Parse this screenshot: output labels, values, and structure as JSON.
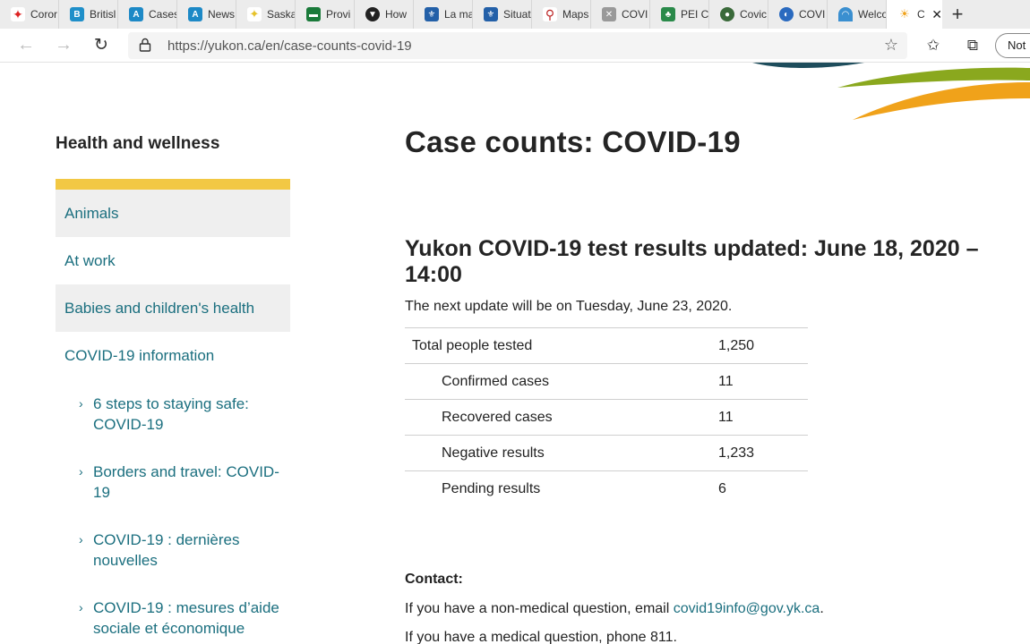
{
  "browser": {
    "tabs": [
      {
        "label": "Coror",
        "color": "#d22"
      },
      {
        "label": "Britisl",
        "color": "#1f8fc9"
      },
      {
        "label": "Cases",
        "color": "#1d89c6"
      },
      {
        "label": "News",
        "color": "#1d89c6"
      },
      {
        "label": "Saska",
        "color": "#e6c22a"
      },
      {
        "label": "Provi",
        "color": "#1a7a3a"
      },
      {
        "label": "How",
        "color": "#222"
      },
      {
        "label": "La ma",
        "color": "#2360a8"
      },
      {
        "label": "Situat",
        "color": "#2360a8"
      },
      {
        "label": "Maps",
        "color": "#b22"
      },
      {
        "label": "COVI",
        "color": "#777"
      },
      {
        "label": "PEI C",
        "color": "#2a8a4a"
      },
      {
        "label": "Covic",
        "color": "#3a6a3a"
      },
      {
        "label": "COVI",
        "color": "#2a6abf"
      },
      {
        "label": "Welco",
        "color": "#3a8fd0"
      },
      {
        "label": "C",
        "color": "#f0a21a",
        "active": true
      }
    ],
    "new_tab_symbol": "+",
    "url": "https://yukon.ca/en/case-counts-covid-19",
    "not_button_label": "Not",
    "icons": {
      "back": "back-arrow-icon",
      "forward": "forward-arrow-icon",
      "reload": "reload-icon",
      "lock": "lock-icon",
      "favorite": "star-icon",
      "favorites": "favorites-list-icon",
      "collections": "collections-icon",
      "close_tab": "close-icon"
    }
  },
  "sidebar": {
    "heading": "Health and wellness",
    "items": [
      {
        "label": "Animals"
      },
      {
        "label": "At work"
      },
      {
        "label": "Babies and children's health"
      },
      {
        "label": "COVID-19 information"
      }
    ],
    "subitems": [
      {
        "label": "6 steps to staying safe: COVID-19"
      },
      {
        "label": "Borders and travel: COVID-19"
      },
      {
        "label": "COVID-19 : dernières nouvelles"
      },
      {
        "label": "COVID-19 : mesures d’aide sociale et économique"
      }
    ]
  },
  "main": {
    "title": "Case counts: COVID-19",
    "subtitle": "Yukon COVID-19 test results updated: June 18, 2020 – 14:00",
    "next_update": "The next update will be on Tuesday, June 23, 2020.",
    "table": [
      {
        "label": "Total people tested",
        "value": "1,250",
        "indent": false
      },
      {
        "label": "Confirmed cases",
        "value": "11",
        "indent": true
      },
      {
        "label": "Recovered cases",
        "value": "11",
        "indent": true
      },
      {
        "label": "Negative results",
        "value": "1,233",
        "indent": true
      },
      {
        "label": "Pending results",
        "value": "6",
        "indent": true
      }
    ],
    "contact_heading": "Contact:",
    "contact_line1_prefix": "If you have a non-medical question, email ",
    "contact_email": "covid19info@gov.yk.ca",
    "contact_line1_suffix": ".",
    "contact_line2": "If you have a medical question, phone 811."
  },
  "colors": {
    "link": "#1b6f7f",
    "sidebar_accent": "#f2c844",
    "brand_green": "#8aa81e",
    "brand_orange": "#f0a21a",
    "brand_teal": "#1e4d5c"
  }
}
